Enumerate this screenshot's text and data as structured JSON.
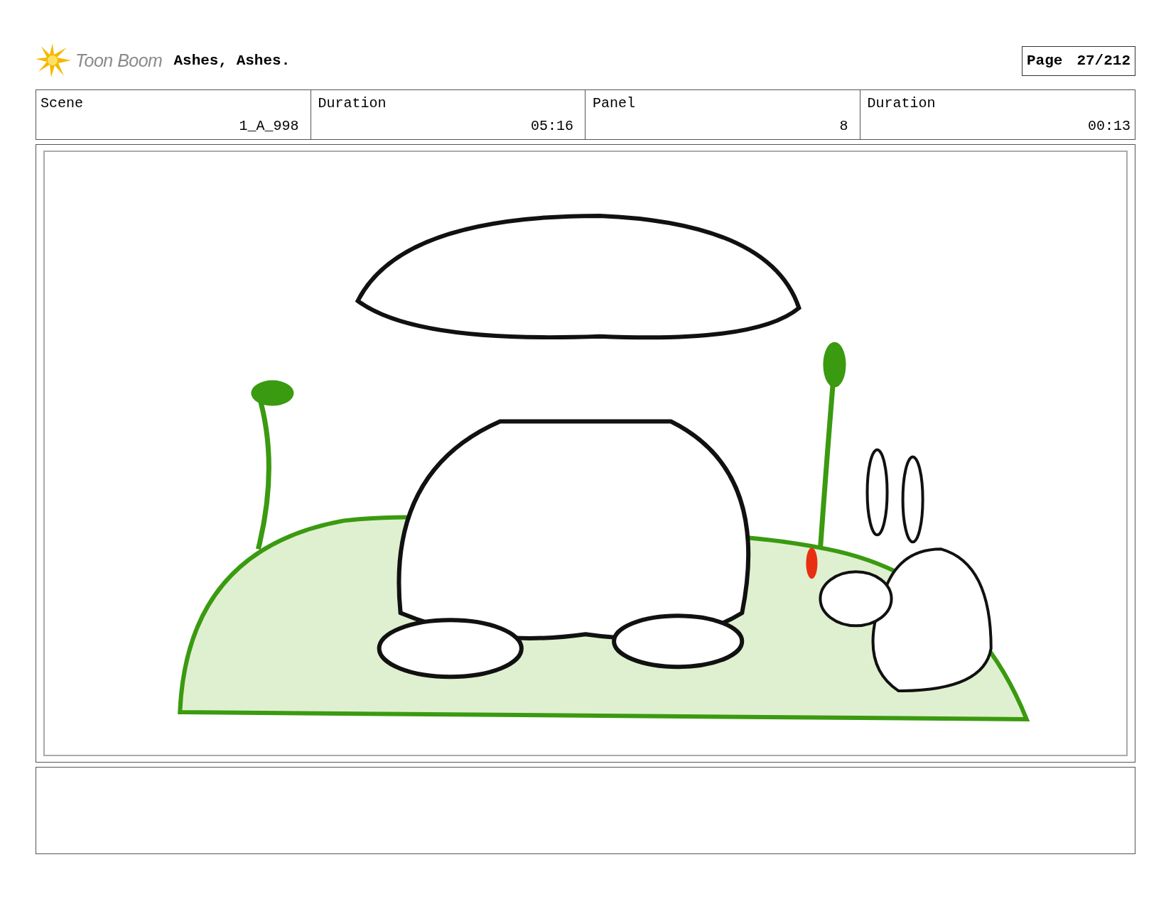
{
  "header": {
    "logo_text": "Toon Boom",
    "title": "Ashes, Ashes.",
    "page_label": "Page",
    "page_number": "27/212"
  },
  "info": [
    {
      "label": "Scene",
      "value": "1_A_998"
    },
    {
      "label": "Duration",
      "value": "05:16"
    },
    {
      "label": "Panel",
      "value": "8"
    },
    {
      "label": "Duration",
      "value": "00:13"
    }
  ]
}
